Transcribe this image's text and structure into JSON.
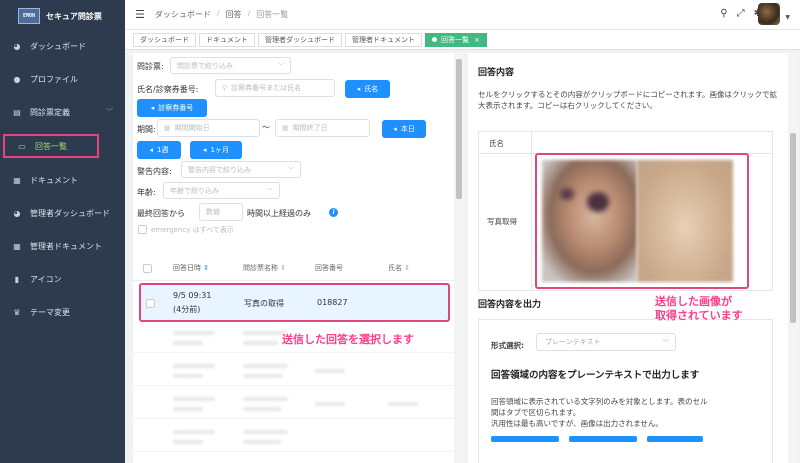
{
  "brand": {
    "logo": "EMON",
    "title": "セキュア問診票"
  },
  "sidebar": {
    "items": [
      {
        "label": "ダッシュボード",
        "icon": "dashboard-icon"
      },
      {
        "label": "プロファイル",
        "icon": "user-icon"
      },
      {
        "label": "問診票定義",
        "icon": "document-icon"
      },
      {
        "label": "回答一覧",
        "icon": "folder-icon"
      },
      {
        "label": "ドキュメント",
        "icon": "file-icon"
      },
      {
        "label": "管理者ダッシュボード",
        "icon": "dashboard-icon"
      },
      {
        "label": "管理者ドキュメント",
        "icon": "file-icon"
      },
      {
        "label": "アイコン",
        "icon": "image-icon"
      },
      {
        "label": "テーマ変更",
        "icon": "shirt-icon"
      }
    ]
  },
  "header": {
    "breadcrumbs": [
      "ダッシュボード",
      "回答",
      "回答一覧"
    ]
  },
  "tabs": [
    {
      "label": "ダッシュボード"
    },
    {
      "label": "ドキュメント"
    },
    {
      "label": "管理者ダッシュボード"
    },
    {
      "label": "管理者ドキュメント"
    },
    {
      "label": "回答一覧",
      "close": "×"
    }
  ],
  "filters": {
    "questionnaire_label": "問診票:",
    "questionnaire_placeholder": "問診票で絞り込み",
    "name_label": "氏名/診察券番号:",
    "name_placeholder": "診察券番号または氏名",
    "name_button": "氏名",
    "card_button": "診察券番号",
    "period_label": "期間:",
    "period_start": "期間開始日",
    "period_tilde": "～",
    "period_end": "期間終了日",
    "today_button": "本日",
    "week_button": "1週",
    "month_button": "1ヶ月",
    "warning_label": "警告内容:",
    "warning_placeholder": "警告内容で絞り込み",
    "age_label": "年齢:",
    "age_placeholder": "年齢で絞り込み",
    "last_answer_label": "最終回答から",
    "last_answer_placeholder": "数値",
    "last_answer_suffix": "時間以上経過のみ",
    "emergency_note": "emergency はすべて表示"
  },
  "table": {
    "headers": [
      "回答日時",
      "問診票名称",
      "回答番号",
      "氏名"
    ],
    "selected_row": {
      "datetime": "9/5 09:31",
      "relative": "(4分前)",
      "name": "写真の取得",
      "number": "018827"
    }
  },
  "annotations": {
    "select_answer": "送信した回答を選択します",
    "image_acquired_line1": "送信した画像が",
    "image_acquired_line2": "取得されています"
  },
  "answer_detail": {
    "title": "回答内容",
    "description": "セルをクリックするとその内容がクリップボードにコピーされます。画像はクリックで拡大表示されます。コピーは右クリックしてください。",
    "rows": [
      {
        "label": "氏名"
      },
      {
        "label": "写真取得"
      }
    ]
  },
  "output": {
    "title": "回答内容を出力",
    "format_label": "形式選択:",
    "format_value": "プレーンテキスト",
    "subtitle": "回答領域の内容をプレーンテキストで出力します",
    "desc_line1": "回答領域に表示されている文字列のみを対象とします。表のセル",
    "desc_line2": "間はタブで区切られます。",
    "desc_line3": "汎用性は最も高いですが、画像は出力されません。"
  }
}
